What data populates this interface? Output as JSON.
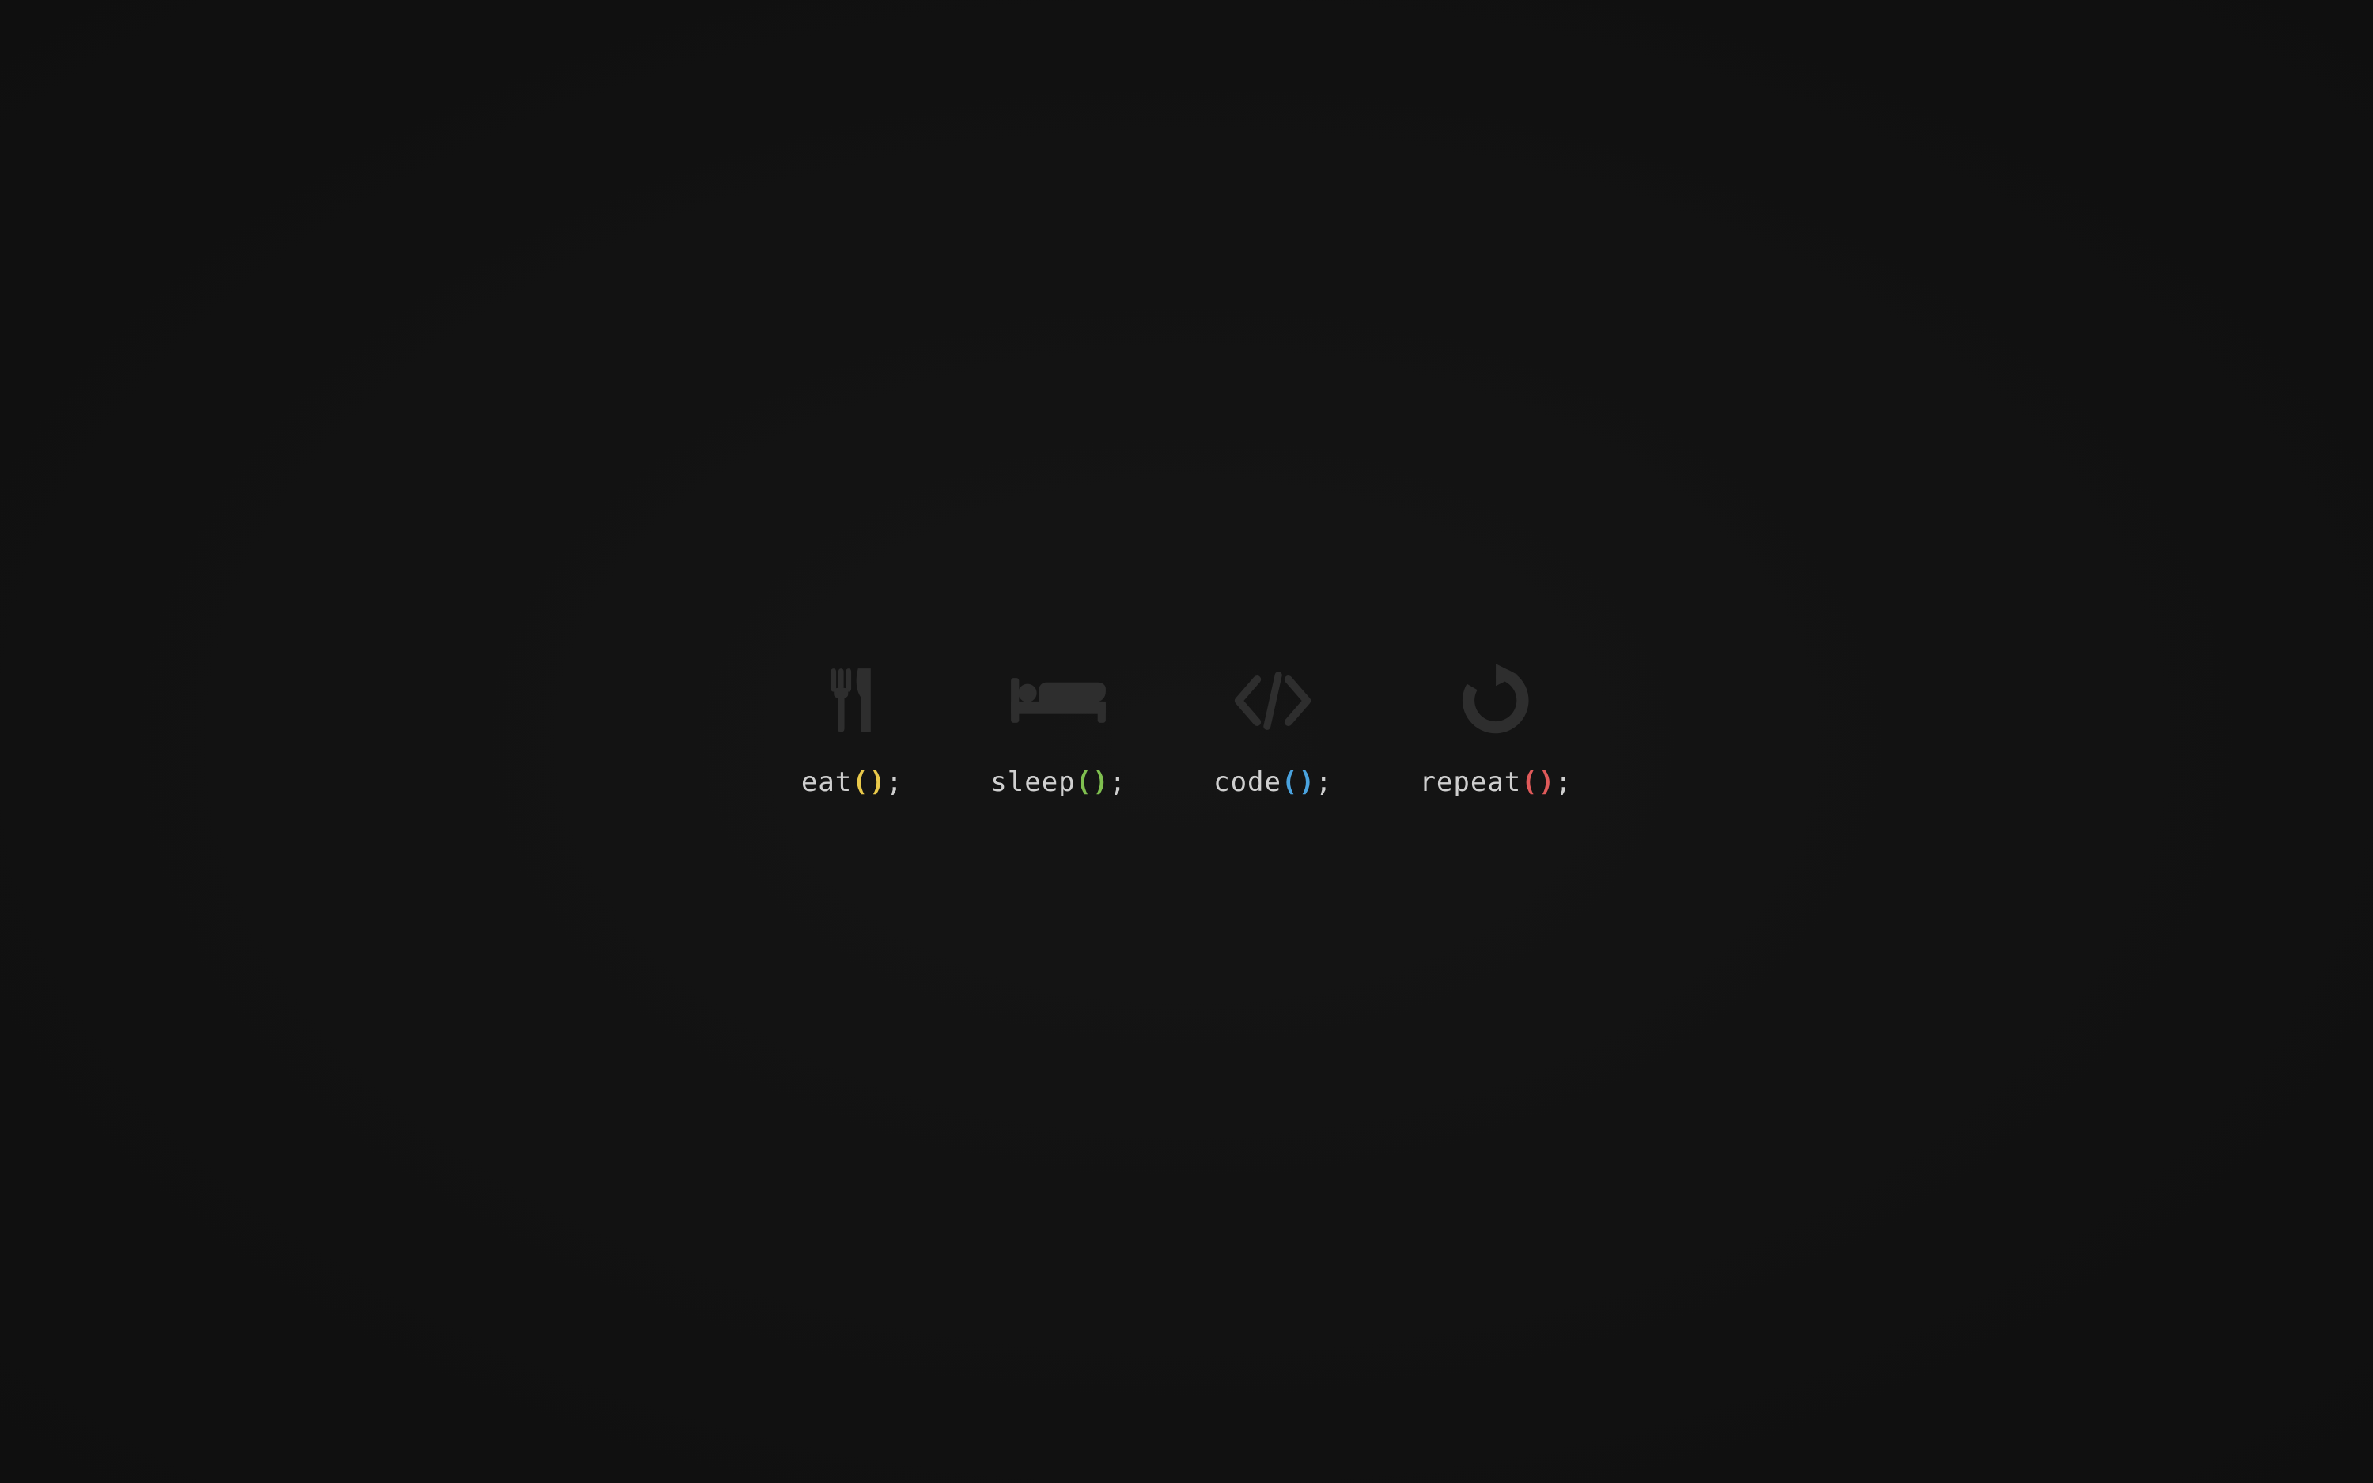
{
  "colors": {
    "background": "#111111",
    "icon": "#2e2e2e",
    "text": "#cfcfcf",
    "yellow": "#e8c84a",
    "green": "#7fbf4f",
    "blue": "#4aa3df",
    "red": "#e05a5a"
  },
  "items": [
    {
      "icon_name": "fork-knife-icon",
      "word": "eat",
      "paren_color": "yellow"
    },
    {
      "icon_name": "bed-icon",
      "word": "sleep",
      "paren_color": "green"
    },
    {
      "icon_name": "code-brackets-icon",
      "word": "code",
      "paren_color": "blue"
    },
    {
      "icon_name": "repeat-icon",
      "word": "repeat",
      "paren_color": "red"
    }
  ],
  "suffix_open": "(",
  "suffix_close": ")",
  "suffix_semi": ";"
}
